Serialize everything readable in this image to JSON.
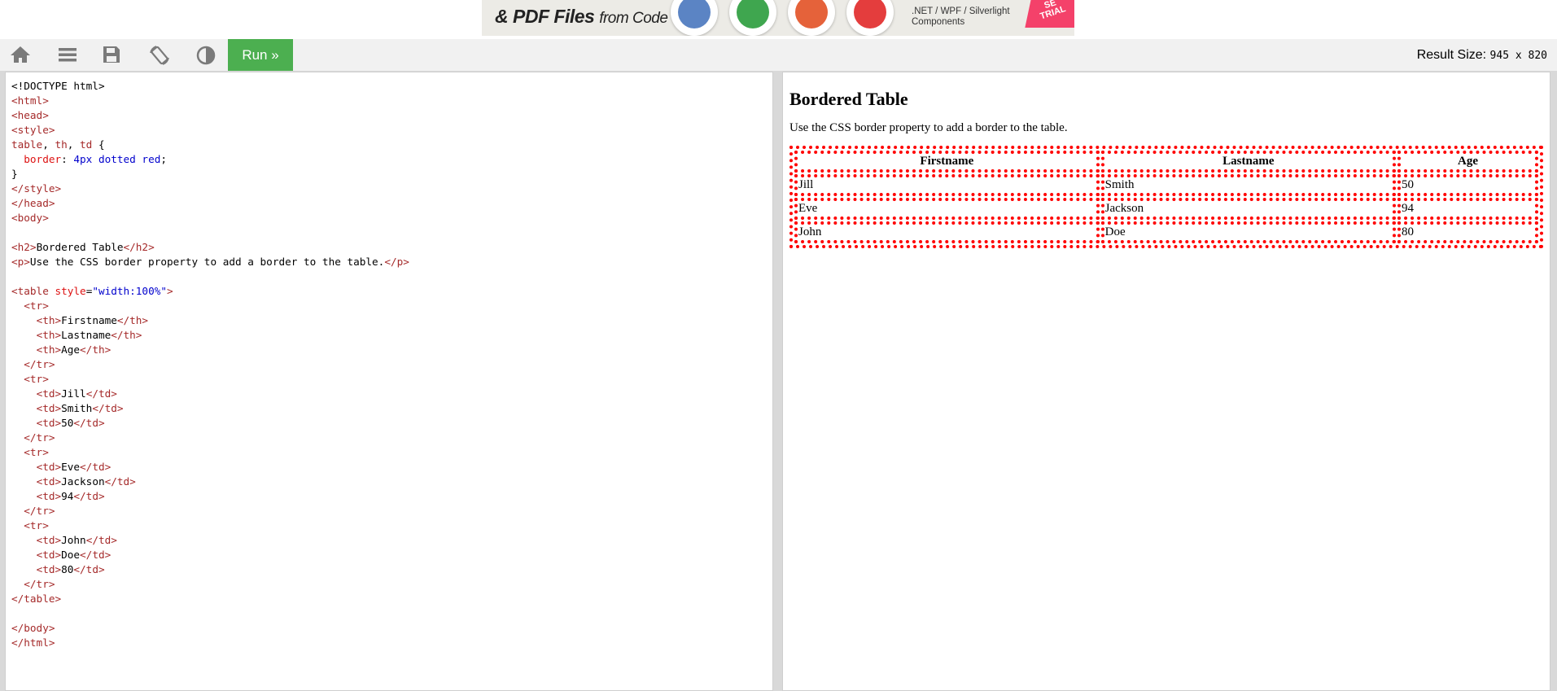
{
  "ad": {
    "headline": "& PDF Files",
    "headline_suffix": "from Code",
    "platforms": ".NET / WPF / Silverlight\nComponents",
    "trial_badge": "SE\nTRIAL"
  },
  "toolbar": {
    "icons": [
      "home-icon",
      "menu-icon",
      "save-icon",
      "rotate-icon",
      "contrast-icon"
    ],
    "run_label": "Run »",
    "result_size_label": "Result Size:",
    "result_size_value": "945 x 820"
  },
  "editor": {
    "lines": [
      [
        [
          "tx",
          "<!DOCTYPE html>"
        ]
      ],
      [
        [
          "tg",
          "<html>"
        ]
      ],
      [
        [
          "tg",
          "<head>"
        ]
      ],
      [
        [
          "tg",
          "<style>"
        ]
      ],
      [
        [
          "tg",
          "table"
        ],
        [
          "tx",
          ", "
        ],
        [
          "tg",
          "th"
        ],
        [
          "tx",
          ", "
        ],
        [
          "tg",
          "td"
        ],
        [
          "tx",
          " {"
        ]
      ],
      [
        [
          "tx",
          "  "
        ],
        [
          "at",
          "border"
        ],
        [
          "tx",
          ": "
        ],
        [
          "vl",
          "4px dotted red"
        ],
        [
          "tx",
          ";"
        ]
      ],
      [
        [
          "tx",
          "}"
        ]
      ],
      [
        [
          "tg",
          "</style>"
        ]
      ],
      [
        [
          "tg",
          "</head>"
        ]
      ],
      [
        [
          "tg",
          "<body>"
        ]
      ],
      [
        [
          "tx",
          ""
        ]
      ],
      [
        [
          "tg",
          "<h2>"
        ],
        [
          "tx",
          "Bordered Table"
        ],
        [
          "tg",
          "</h2>"
        ]
      ],
      [
        [
          "tg",
          "<p>"
        ],
        [
          "tx",
          "Use the CSS border property to add a border to the table."
        ],
        [
          "tg",
          "</p>"
        ]
      ],
      [
        [
          "tx",
          ""
        ]
      ],
      [
        [
          "tg",
          "<table"
        ],
        [
          "tx",
          " "
        ],
        [
          "at",
          "style"
        ],
        [
          "tx",
          "="
        ],
        [
          "vl",
          "\"width:100%\""
        ],
        [
          "tg",
          ">"
        ]
      ],
      [
        [
          "tx",
          "  "
        ],
        [
          "tg",
          "<tr>"
        ]
      ],
      [
        [
          "tx",
          "    "
        ],
        [
          "tg",
          "<th>"
        ],
        [
          "tx",
          "Firstname"
        ],
        [
          "tg",
          "</th>"
        ]
      ],
      [
        [
          "tx",
          "    "
        ],
        [
          "tg",
          "<th>"
        ],
        [
          "tx",
          "Lastname"
        ],
        [
          "tg",
          "</th>"
        ]
      ],
      [
        [
          "tx",
          "    "
        ],
        [
          "tg",
          "<th>"
        ],
        [
          "tx",
          "Age"
        ],
        [
          "tg",
          "</th>"
        ]
      ],
      [
        [
          "tx",
          "  "
        ],
        [
          "tg",
          "</tr>"
        ]
      ],
      [
        [
          "tx",
          "  "
        ],
        [
          "tg",
          "<tr>"
        ]
      ],
      [
        [
          "tx",
          "    "
        ],
        [
          "tg",
          "<td>"
        ],
        [
          "tx",
          "Jill"
        ],
        [
          "tg",
          "</td>"
        ]
      ],
      [
        [
          "tx",
          "    "
        ],
        [
          "tg",
          "<td>"
        ],
        [
          "tx",
          "Smith"
        ],
        [
          "tg",
          "</td>"
        ]
      ],
      [
        [
          "tx",
          "    "
        ],
        [
          "tg",
          "<td>"
        ],
        [
          "tx",
          "50"
        ],
        [
          "tg",
          "</td>"
        ]
      ],
      [
        [
          "tx",
          "  "
        ],
        [
          "tg",
          "</tr>"
        ]
      ],
      [
        [
          "tx",
          "  "
        ],
        [
          "tg",
          "<tr>"
        ]
      ],
      [
        [
          "tx",
          "    "
        ],
        [
          "tg",
          "<td>"
        ],
        [
          "tx",
          "Eve"
        ],
        [
          "tg",
          "</td>"
        ]
      ],
      [
        [
          "tx",
          "    "
        ],
        [
          "tg",
          "<td>"
        ],
        [
          "tx",
          "Jackson"
        ],
        [
          "tg",
          "</td>"
        ]
      ],
      [
        [
          "tx",
          "    "
        ],
        [
          "tg",
          "<td>"
        ],
        [
          "tx",
          "94"
        ],
        [
          "tg",
          "</td>"
        ]
      ],
      [
        [
          "tx",
          "  "
        ],
        [
          "tg",
          "</tr>"
        ]
      ],
      [
        [
          "tx",
          "  "
        ],
        [
          "tg",
          "<tr>"
        ]
      ],
      [
        [
          "tx",
          "    "
        ],
        [
          "tg",
          "<td>"
        ],
        [
          "tx",
          "John"
        ],
        [
          "tg",
          "</td>"
        ]
      ],
      [
        [
          "tx",
          "    "
        ],
        [
          "tg",
          "<td>"
        ],
        [
          "tx",
          "Doe"
        ],
        [
          "tg",
          "</td>"
        ]
      ],
      [
        [
          "tx",
          "    "
        ],
        [
          "tg",
          "<td>"
        ],
        [
          "tx",
          "80"
        ],
        [
          "tg",
          "</td>"
        ]
      ],
      [
        [
          "tx",
          "  "
        ],
        [
          "tg",
          "</tr>"
        ]
      ],
      [
        [
          "tg",
          "</table>"
        ]
      ],
      [
        [
          "tx",
          ""
        ]
      ],
      [
        [
          "tg",
          "</body>"
        ]
      ],
      [
        [
          "tg",
          "</html>"
        ]
      ]
    ]
  },
  "result": {
    "heading": "Bordered Table",
    "paragraph": "Use the CSS border property to add a border to the table.",
    "table": {
      "headers": [
        "Firstname",
        "Lastname",
        "Age"
      ],
      "rows": [
        [
          "Jill",
          "Smith",
          "50"
        ],
        [
          "Eve",
          "Jackson",
          "94"
        ],
        [
          "John",
          "Doe",
          "80"
        ]
      ]
    }
  },
  "colors": {
    "run_button": "#4CAF50",
    "code_tag": "#a52a2a",
    "code_attr": "#dd1111",
    "code_value": "#0000cd",
    "table_border": "red"
  }
}
